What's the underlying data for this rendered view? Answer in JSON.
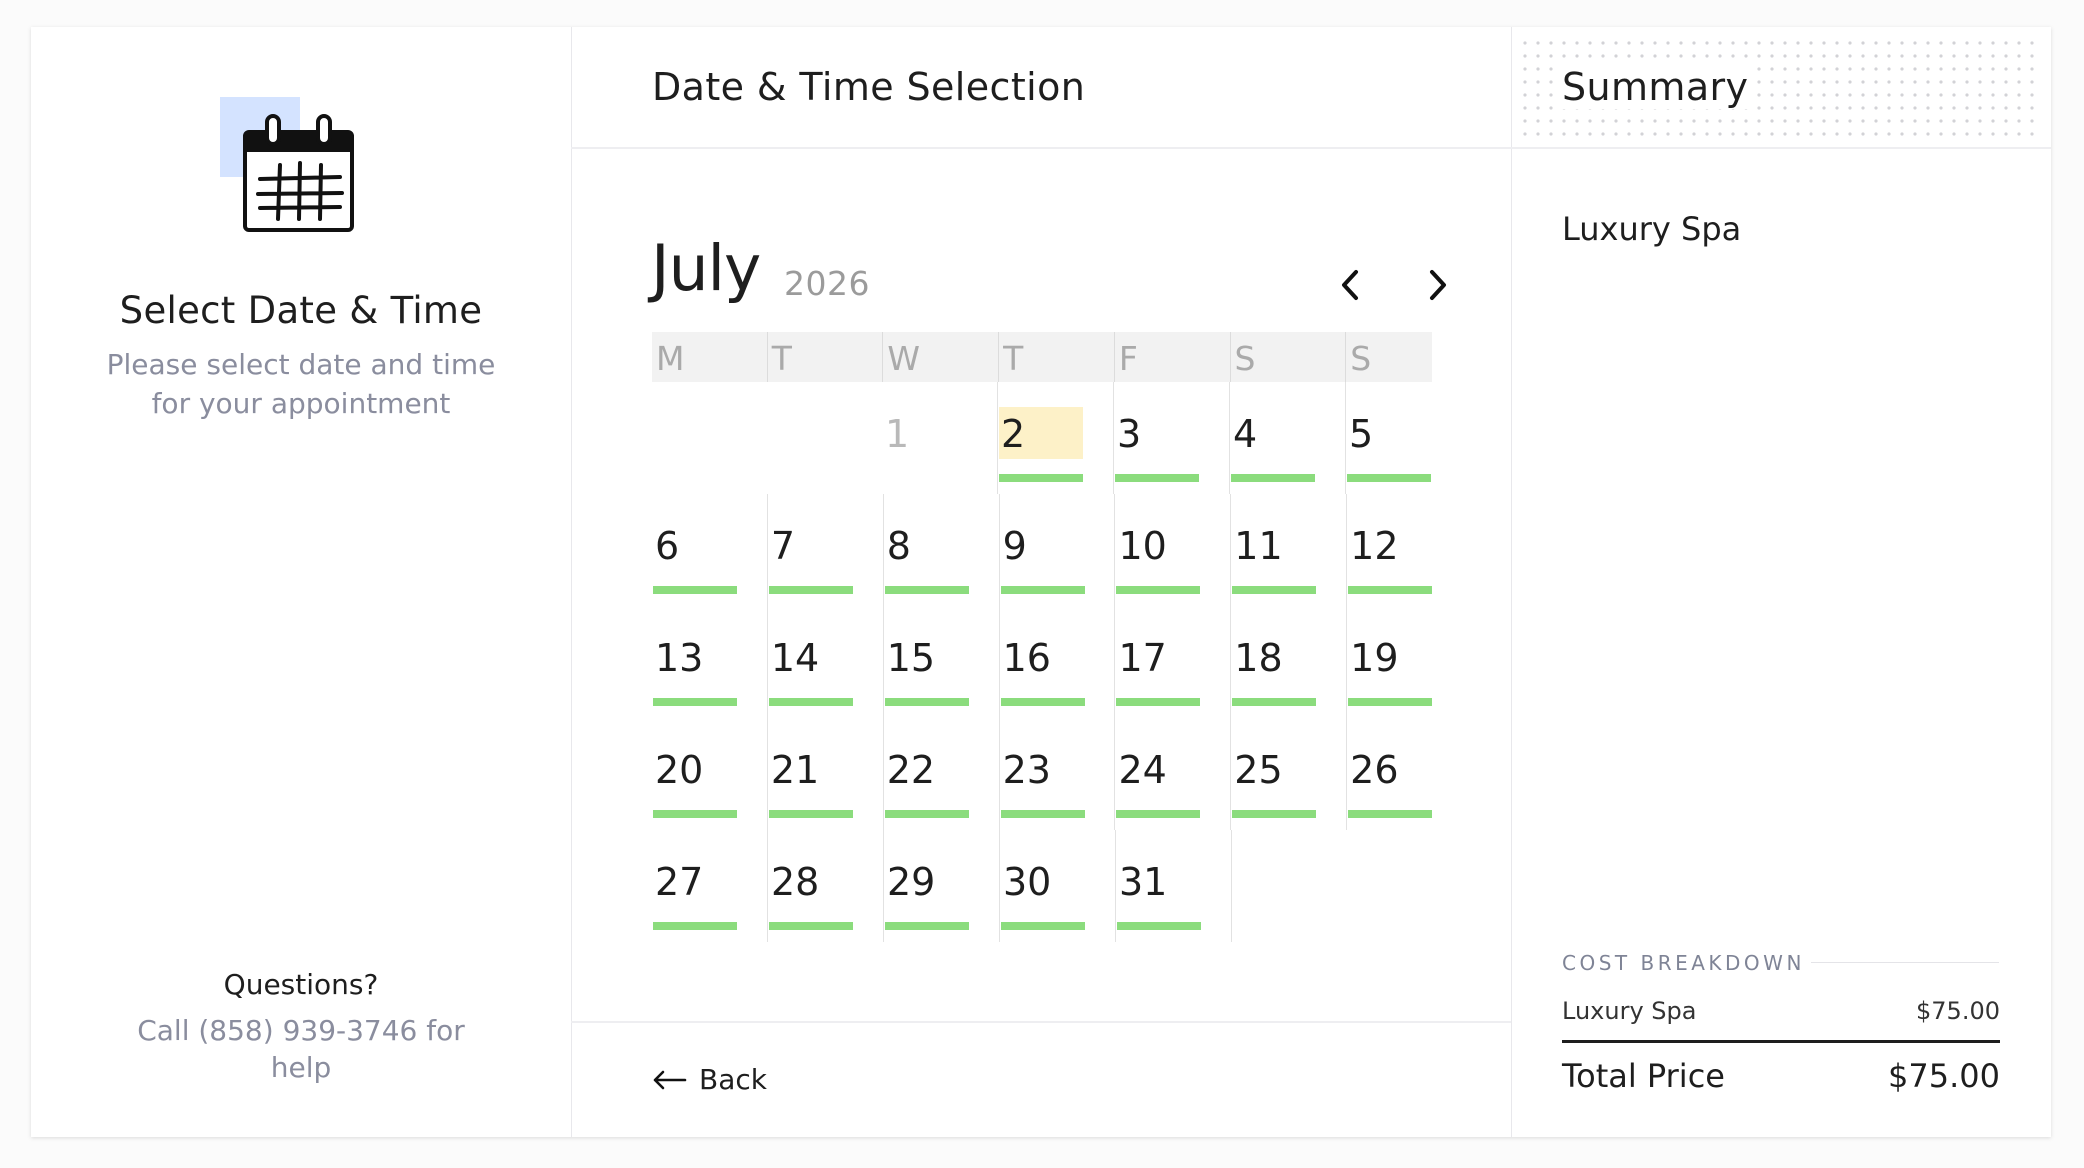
{
  "left": {
    "title": "Select Date & Time",
    "subtitle": "Please select date and time for your appointment",
    "questions": "Questions?",
    "call": "Call (858) 939-3746 for help"
  },
  "center": {
    "title": "Date & Time Selection",
    "month": "July",
    "year": "2026",
    "weekdays": [
      "M",
      "T",
      "W",
      "T",
      "F",
      "S",
      "S"
    ],
    "weeks": [
      [
        null,
        null,
        {
          "d": "1",
          "muted": true
        },
        {
          "d": "2",
          "avail": true,
          "selected": true
        },
        {
          "d": "3",
          "avail": true
        },
        {
          "d": "4",
          "avail": true
        },
        {
          "d": "5",
          "avail": true
        }
      ],
      [
        {
          "d": "6",
          "avail": true
        },
        {
          "d": "7",
          "avail": true
        },
        {
          "d": "8",
          "avail": true
        },
        {
          "d": "9",
          "avail": true
        },
        {
          "d": "10",
          "avail": true
        },
        {
          "d": "11",
          "avail": true
        },
        {
          "d": "12",
          "avail": true
        }
      ],
      [
        {
          "d": "13",
          "avail": true
        },
        {
          "d": "14",
          "avail": true
        },
        {
          "d": "15",
          "avail": true
        },
        {
          "d": "16",
          "avail": true
        },
        {
          "d": "17",
          "avail": true
        },
        {
          "d": "18",
          "avail": true
        },
        {
          "d": "19",
          "avail": true
        }
      ],
      [
        {
          "d": "20",
          "avail": true
        },
        {
          "d": "21",
          "avail": true
        },
        {
          "d": "22",
          "avail": true
        },
        {
          "d": "23",
          "avail": true
        },
        {
          "d": "24",
          "avail": true
        },
        {
          "d": "25",
          "avail": true
        },
        {
          "d": "26",
          "avail": true
        }
      ],
      [
        {
          "d": "27",
          "avail": true
        },
        {
          "d": "28",
          "avail": true
        },
        {
          "d": "29",
          "avail": true
        },
        {
          "d": "30",
          "avail": true
        },
        {
          "d": "31",
          "avail": true
        },
        null,
        null
      ]
    ],
    "back_label": "Back",
    "prev_icon": "chevron-left-icon",
    "next_icon": "chevron-right-icon"
  },
  "summary": {
    "title": "Summary",
    "service": "Luxury Spa",
    "cost_breakdown_label": "COST BREAKDOWN",
    "item_name": "Luxury Spa",
    "item_price": "$75.00",
    "total_label": "Total Price",
    "total_value": "$75.00"
  },
  "colors": {
    "available": "#8bdc7d",
    "selected": "#fdf1c8",
    "muted_text": "#8a8d9e",
    "illustration_accent": "#d4e3ff"
  }
}
